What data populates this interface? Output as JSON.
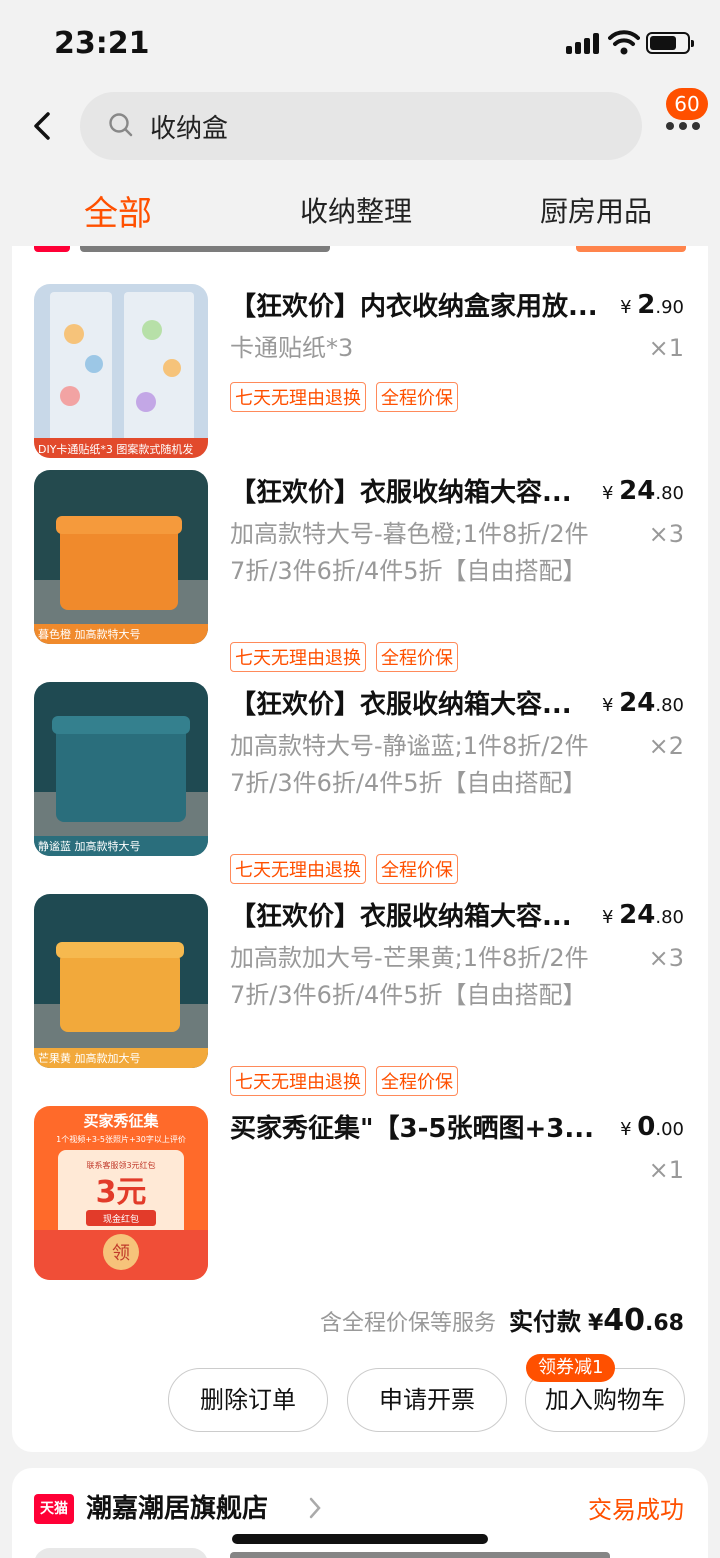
{
  "status_bar": {
    "time": "23:21"
  },
  "search": {
    "query": "收纳盒",
    "badge_count": "60"
  },
  "tabs": [
    {
      "label": "全部",
      "active": true
    },
    {
      "label": "收纳整理",
      "active": false
    },
    {
      "label": "厨房用品",
      "active": false
    }
  ],
  "order": {
    "items": [
      {
        "title": "【狂欢价】内衣收纳盒家用放...",
        "price_int": "2",
        "price_dec": ".90",
        "currency": "¥",
        "sku": "卡通贴纸*3",
        "qty": "×1",
        "tags": [
          "七天无理由退换",
          "全程价保"
        ],
        "thumb_caption": "DIY卡通贴纸*3 图案款式随机发",
        "thumb_color": "#c8d8e8"
      },
      {
        "title": "【狂欢价】衣服收纳箱大容...",
        "price_int": "24",
        "price_dec": ".80",
        "currency": "¥",
        "sku": "加高款特大号-暮色橙;1件8折/2件7折/3件6折/4件5折【自由搭配】",
        "qty": "×3",
        "tags": [
          "七天无理由退换",
          "全程价保"
        ],
        "thumb_caption": "暮色橙 加高款特大号",
        "thumb_color": "#f08a2c"
      },
      {
        "title": "【狂欢价】衣服收纳箱大容...",
        "price_int": "24",
        "price_dec": ".80",
        "currency": "¥",
        "sku": "加高款特大号-静谧蓝;1件8折/2件7折/3件6折/4件5折【自由搭配】",
        "qty": "×2",
        "tags": [
          "七天无理由退换",
          "全程价保"
        ],
        "thumb_caption": "静谧蓝 加高款特大号",
        "thumb_color": "#2a6e7c"
      },
      {
        "title": "【狂欢价】衣服收纳箱大容...",
        "price_int": "24",
        "price_dec": ".80",
        "currency": "¥",
        "sku": "加高款加大号-芒果黄;1件8折/2件7折/3件6折/4件5折【自由搭配】",
        "qty": "×3",
        "tags": [
          "七天无理由退换",
          "全程价保"
        ],
        "thumb_caption": "芒果黄 加高款加大号",
        "thumb_color": "#f2a93b"
      },
      {
        "title": "买家秀征集\"【3-5张晒图+3...",
        "price_int": "0",
        "price_dec": ".00",
        "currency": "¥",
        "sku": "",
        "qty": "×1",
        "tags": [],
        "thumb_caption": "买家秀征集",
        "thumb_sub": "1个视频+3-5张照片+30字以上评价",
        "thumb_coupon": "3元",
        "thumb_coupon_label": "现金红包",
        "thumb_claim": "领",
        "thumb_note": "联系客服领3元红包",
        "thumb_color": "#ff6a2a"
      }
    ],
    "summary": {
      "service_note": "含全程价保等服务",
      "label": "实付款",
      "currency": "¥",
      "amount_int": "40",
      "amount_dec": ".68"
    },
    "actions": {
      "delete": "删除订单",
      "invoice": "申请开票",
      "add_cart": "加入购物车",
      "coupon_badge": "领券减1"
    }
  },
  "next_shop": {
    "logo": "天猫",
    "name": "潮嘉潮居旗舰店",
    "status": "交易成功"
  }
}
